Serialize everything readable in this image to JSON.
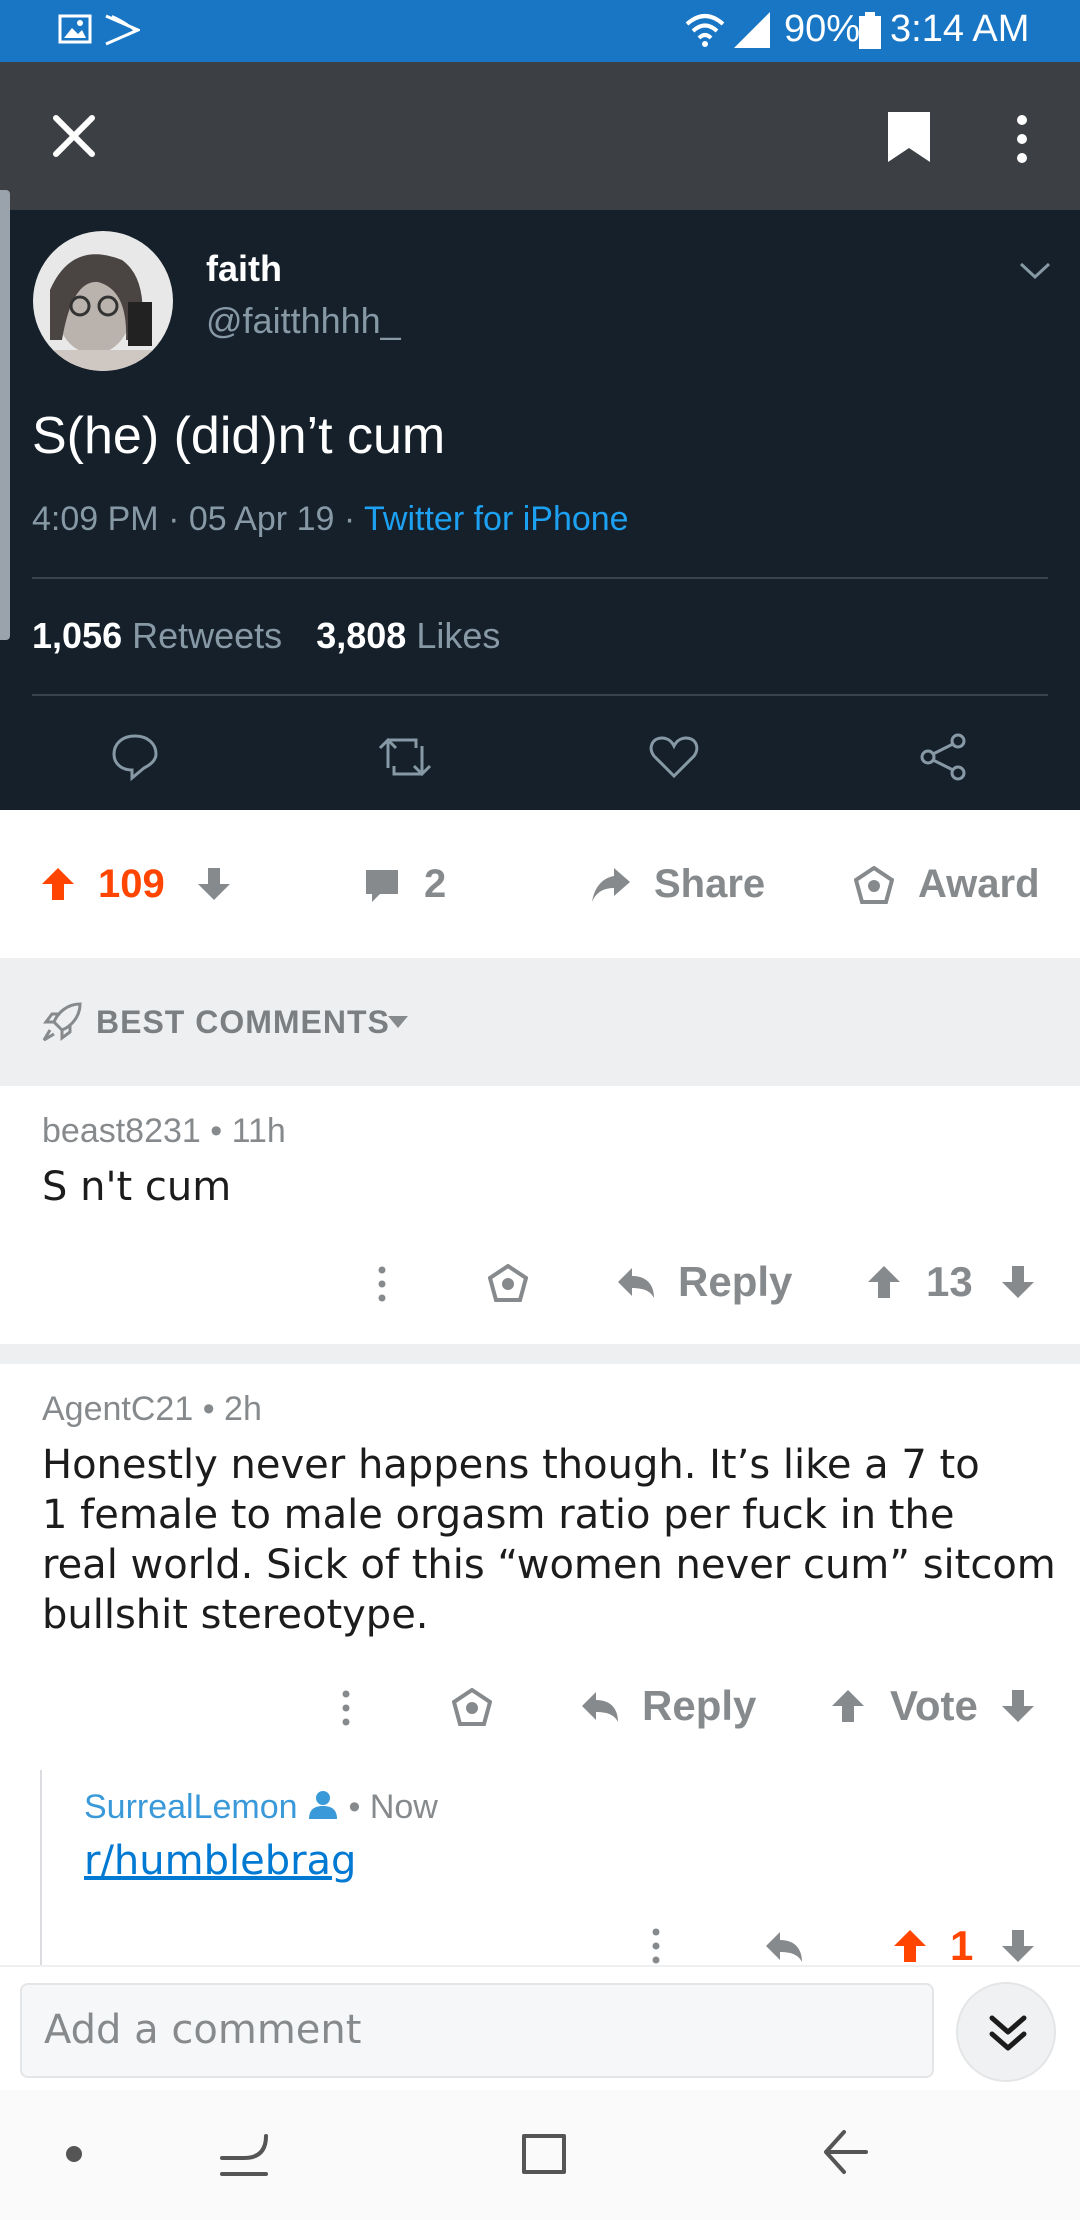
{
  "status_bar": {
    "battery": "90%",
    "time": "3:14 AM",
    "icons": [
      "gallery-icon",
      "sprint-icon",
      "wifi-icon",
      "signal-icon",
      "battery-icon"
    ]
  },
  "toolbar": {
    "icons": [
      "close-icon",
      "bookmark-icon",
      "more-vert-icon"
    ]
  },
  "tweet": {
    "display_name": "faith",
    "handle": "@faitthhhh_",
    "text": "S(he) (did)n’t cum",
    "time": "4:09 PM · 05 Apr 19 ·",
    "source": "Twitter for iPhone",
    "retweets_count": "1,056",
    "retweets_label": "Retweets",
    "likes_count": "3,808",
    "likes_label": "Likes"
  },
  "post_actions": {
    "score": "109",
    "comments": "2",
    "share_label": "Share",
    "award_label": "Award"
  },
  "sort": {
    "label": "BEST COMMENTS"
  },
  "comments": [
    {
      "author": "beast8231",
      "age": "• 11h",
      "body": "S n't cum",
      "reply_label": "Reply",
      "score": "13"
    },
    {
      "author": "AgentC21",
      "age": "• 2h",
      "body_lines": [
        "Honestly never happens though. It’s like a 7 to",
        "1  female to male orgasm ratio per fuck in the",
        "real world. Sick of this “women never cum” sitcom",
        "bullshit stereotype."
      ],
      "reply_label": "Reply",
      "score": "Vote"
    },
    {
      "author": "SurrealLemon",
      "age": "• Now",
      "link": "r/humblebrag",
      "score": "1"
    }
  ],
  "comment_input": {
    "placeholder": "Add a comment"
  },
  "colors": {
    "status_bar": "#1976c5",
    "toolbar": "#3c3f44",
    "tweet_bg": "#15202b",
    "upvote_orange": "#ff4500",
    "link_blue": "#0079d3",
    "muted": "#878a8c"
  }
}
